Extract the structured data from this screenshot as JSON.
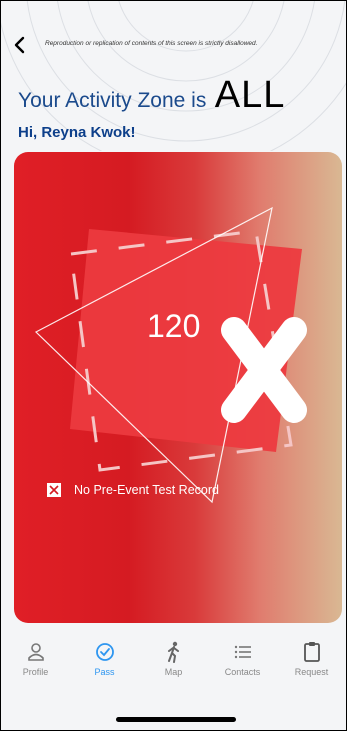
{
  "header": {
    "disclaimer": "Reproduction or replication of contents of this screen is strictly disallowed.",
    "zone_label": "Your Activity Zone is",
    "zone_value": "ALL",
    "greeting": "Hi, Reyna Kwok!"
  },
  "pass": {
    "number": "120",
    "status_icon": "x-mark-icon",
    "test_status_text": "No Pre-Event Test Record",
    "colors": {
      "card_red": "#d51b22",
      "card_tan": "#d9b893"
    }
  },
  "nav": {
    "items": [
      {
        "label": "Profile",
        "icon": "person-icon",
        "active": false
      },
      {
        "label": "Pass",
        "icon": "check-circle-icon",
        "active": true
      },
      {
        "label": "Map",
        "icon": "walking-person-icon",
        "active": false
      },
      {
        "label": "Contacts",
        "icon": "list-icon",
        "active": false
      },
      {
        "label": "Request",
        "icon": "clipboard-icon",
        "active": false
      }
    ],
    "active_color": "#2e96f0"
  }
}
